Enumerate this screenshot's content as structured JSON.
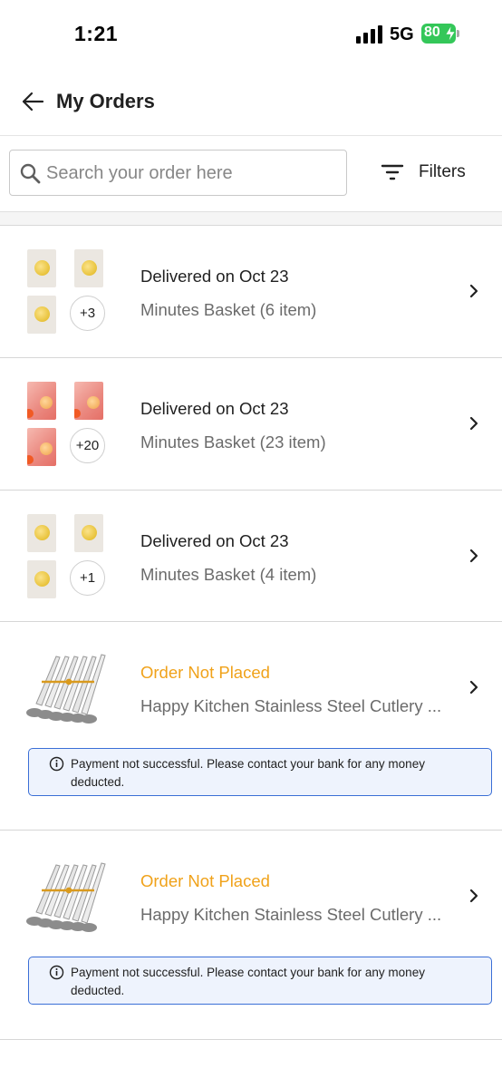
{
  "status_bar": {
    "time": "1:21",
    "network": "5G",
    "battery": "80",
    "battery_color": "#34c759"
  },
  "header": {
    "title": "My Orders",
    "back_icon": "arrow-left-icon"
  },
  "search": {
    "placeholder": "Search your order here",
    "value": ""
  },
  "filters": {
    "label": "Filters",
    "icon": "filter-lines-icon"
  },
  "orders": [
    {
      "status": "Delivered on Oct 23",
      "subtitle": "Minutes Basket (6 item)",
      "more": "+3",
      "thumb_type": "cheese"
    },
    {
      "status": "Delivered on Oct 23",
      "subtitle": "Minutes Basket (23 item)",
      "more": "+20",
      "thumb_type": "candy"
    },
    {
      "status": "Delivered on Oct 23",
      "subtitle": "Minutes Basket (4 item)",
      "more": "+1",
      "thumb_type": "cheese"
    },
    {
      "status": "Order Not Placed",
      "subtitle": "Happy Kitchen Stainless Steel Cutlery ...",
      "alert": "Payment not successful. Please contact your bank for any money deducted."
    },
    {
      "status": "Order Not Placed",
      "subtitle": "Happy Kitchen Stainless Steel Cutlery ...",
      "alert": "Payment not successful. Please contact your bank for any money deducted."
    }
  ],
  "colors": {
    "failed_status": "#f0a21a",
    "alert_border": "#3b6fd6",
    "alert_background": "#eef3fd"
  }
}
